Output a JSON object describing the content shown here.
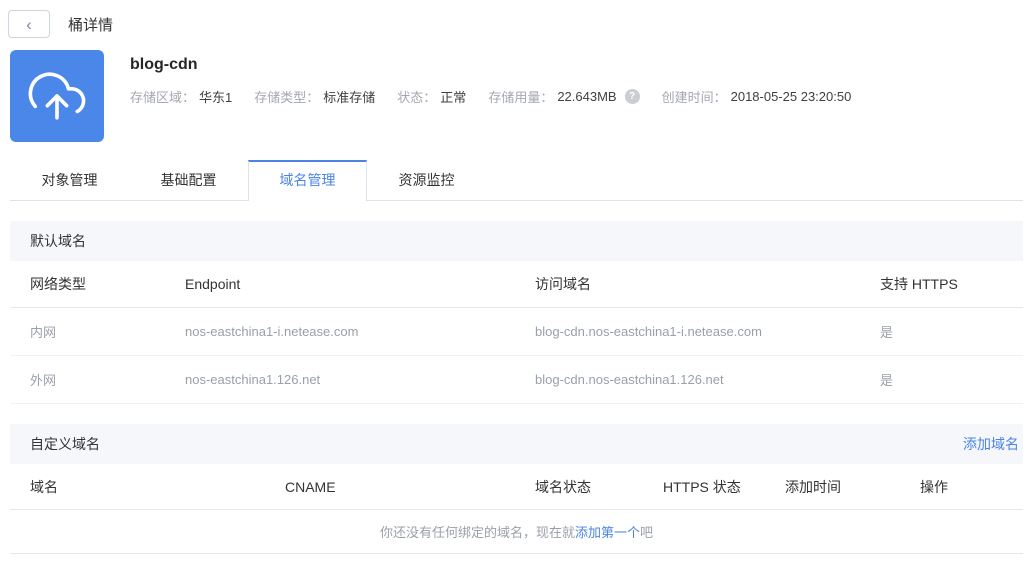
{
  "colors": {
    "accent": "#4a84e6",
    "icon_bg": "#4a87e8",
    "section_bg": "#f5f7fa"
  },
  "icons": {
    "back": "‹",
    "help": "?",
    "bucket": "cloud-upload-icon"
  },
  "header": {
    "title": "桶详情"
  },
  "bucket": {
    "name": "blog-cdn",
    "meta": [
      {
        "label": "存储区域：",
        "value": "华东1"
      },
      {
        "label": "存储类型：",
        "value": "标准存储"
      },
      {
        "label": "状态：",
        "value": "正常"
      },
      {
        "label": "存储用量：",
        "value": "22.643MB"
      },
      {
        "label": "创建时间：",
        "value": "2018-05-25 23:20:50"
      }
    ]
  },
  "tabs": [
    {
      "label": "对象管理",
      "active": false
    },
    {
      "label": "基础配置",
      "active": false
    },
    {
      "label": "域名管理",
      "active": true
    },
    {
      "label": "资源监控",
      "active": false
    }
  ],
  "default_domains": {
    "section_title": "默认域名",
    "columns": [
      "网络类型",
      "Endpoint",
      "访问域名",
      "支持 HTTPS"
    ],
    "rows": [
      [
        "内网",
        "nos-eastchina1-i.netease.com",
        "blog-cdn.nos-eastchina1-i.netease.com",
        "是"
      ],
      [
        "外网",
        "nos-eastchina1.126.net",
        "blog-cdn.nos-eastchina1.126.net",
        "是"
      ]
    ]
  },
  "custom_domains": {
    "section_title": "自定义域名",
    "add_button": "添加域名",
    "columns": [
      "域名",
      "CNAME",
      "域名状态",
      "HTTPS 状态",
      "添加时间",
      "操作"
    ],
    "empty": {
      "prefix": "你还没有任何绑定的域名，现在就",
      "link": "添加第一个",
      "suffix": "吧"
    }
  }
}
